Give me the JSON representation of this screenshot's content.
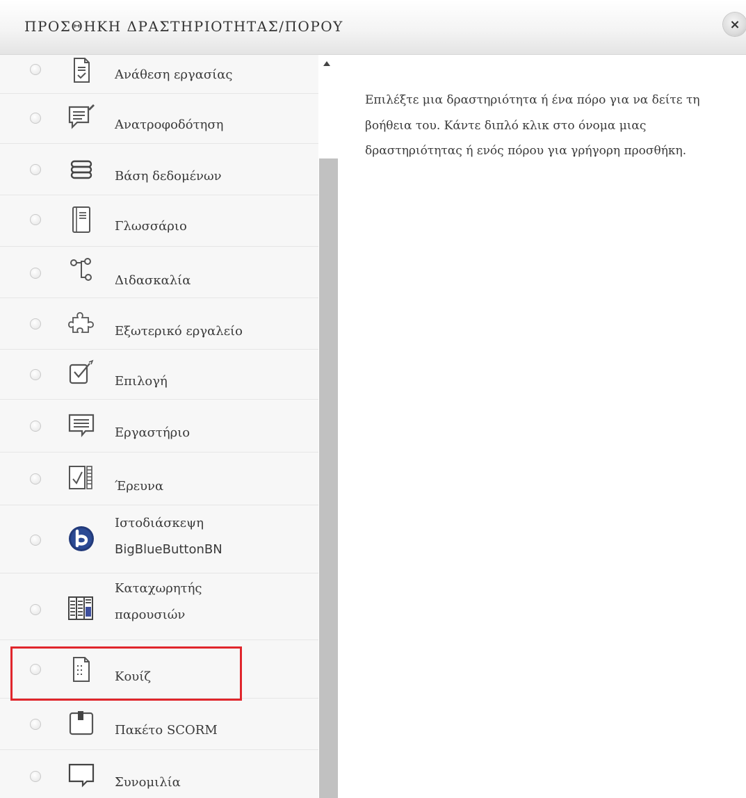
{
  "header": {
    "title": "ΠΡΟΣΘΗΚΗ ΔΡΑΣΤΗΡΙΟΤΗΤΑΣ/ΠΟΡΟΥ",
    "close_symbol": "×"
  },
  "options": [
    {
      "label": "Ανάθεση εργασίας",
      "icon": "assignment-icon"
    },
    {
      "label": "Ανατροφοδότηση",
      "icon": "feedback-icon"
    },
    {
      "label": "Βάση δεδομένων",
      "icon": "database-icon"
    },
    {
      "label": "Γλωσσάριο",
      "icon": "glossary-icon"
    },
    {
      "label": "Διδασκαλία",
      "icon": "lesson-icon"
    },
    {
      "label": "Εξωτερικό εργαλείο",
      "icon": "puzzle-icon"
    },
    {
      "label": "Επιλογή",
      "icon": "choice-icon"
    },
    {
      "label": "Εργαστήριο",
      "icon": "workshop-icon"
    },
    {
      "label": "Έρευνα",
      "icon": "survey-icon"
    },
    {
      "label_line1": "Ιστοδιάσκεψη",
      "label_line2": "BigBlueButtonBN",
      "icon": "bigbluebutton-icon"
    },
    {
      "label_line1": "Καταχωρητής",
      "label_line2": "παρουσιών",
      "icon": "attendance-icon"
    },
    {
      "label": "Κουίζ",
      "icon": "quiz-icon",
      "highlighted": true
    },
    {
      "label": "Πακέτο SCORM",
      "icon": "scorm-icon"
    },
    {
      "label": "Συνομιλία",
      "icon": "chat-icon"
    }
  ],
  "help_text": "Επιλέξτε μια δραστηριότητα ή ένα πόρο για να δείτε τη βοήθεια του. Κάντε διπλό κλικ στο όνομα μιας δραστηριότητας ή ενός πόρου για γρήγορη προσθήκη.",
  "colors": {
    "highlight_border": "#e0262c",
    "header_bg": "#f4f4f4",
    "panel_bg": "#f7f7f7",
    "scrollbar_thumb": "#c1c1c1"
  }
}
